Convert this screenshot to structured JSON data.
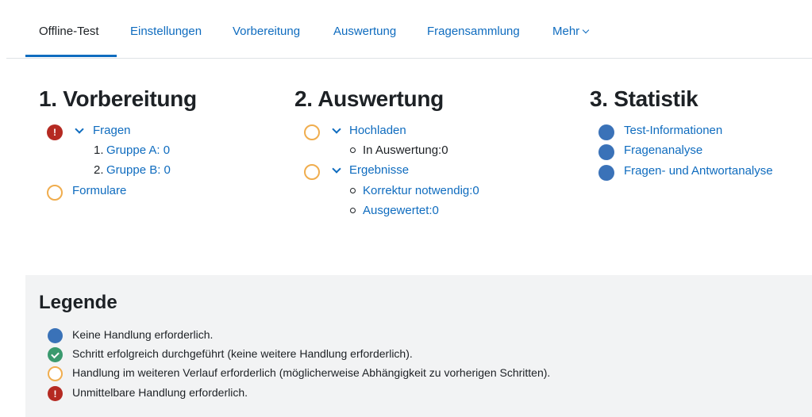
{
  "tabs": [
    {
      "label": "Offline-Test"
    },
    {
      "label": "Einstellungen"
    },
    {
      "label": "Vorbereitung"
    },
    {
      "label": "Auswertung"
    },
    {
      "label": "Fragensammlung"
    },
    {
      "label": "Mehr"
    }
  ],
  "sections": {
    "prep": {
      "title": "1. Vorbereitung",
      "fragen": "Fragen",
      "groups": [
        {
          "num": "1.",
          "label": "Gruppe A: 0"
        },
        {
          "num": "2.",
          "label": "Gruppe B: 0"
        }
      ],
      "formulare": "Formulare"
    },
    "eval": {
      "title": "2. Auswertung",
      "hochladen": "Hochladen",
      "in_auswertung": "In Auswertung:0",
      "ergebnisse": "Ergebnisse",
      "korrektur": "Korrektur notwendig:0",
      "ausgewertet": "Ausgewertet:0"
    },
    "stats": {
      "title": "3. Statistik",
      "items": [
        {
          "label": "Test-Informationen"
        },
        {
          "label": "Fragenanalyse"
        },
        {
          "label": "Fragen- und Antwortanalyse"
        }
      ]
    }
  },
  "legend": {
    "title": "Legende",
    "items": [
      {
        "icon": "blue-circle-icon",
        "text": "Keine Handlung erforderlich."
      },
      {
        "icon": "green-check-icon",
        "text": "Schritt erfolgreich durchgeführt (keine weitere Handlung erforderlich)."
      },
      {
        "icon": "orange-ring-icon",
        "text": "Handlung im weiteren Verlauf erforderlich (möglicherweise Abhängigkeit zu vorherigen Schritten)."
      },
      {
        "icon": "red-exclamation-icon",
        "text": "Unmittelbare Handlung erforderlich."
      }
    ]
  },
  "colors": {
    "link": "#0f6cbf",
    "blue_status": "#3a72b8",
    "orange_status": "#f0ad4e",
    "red_status": "#b52a22",
    "green_status": "#3a9a6e"
  }
}
